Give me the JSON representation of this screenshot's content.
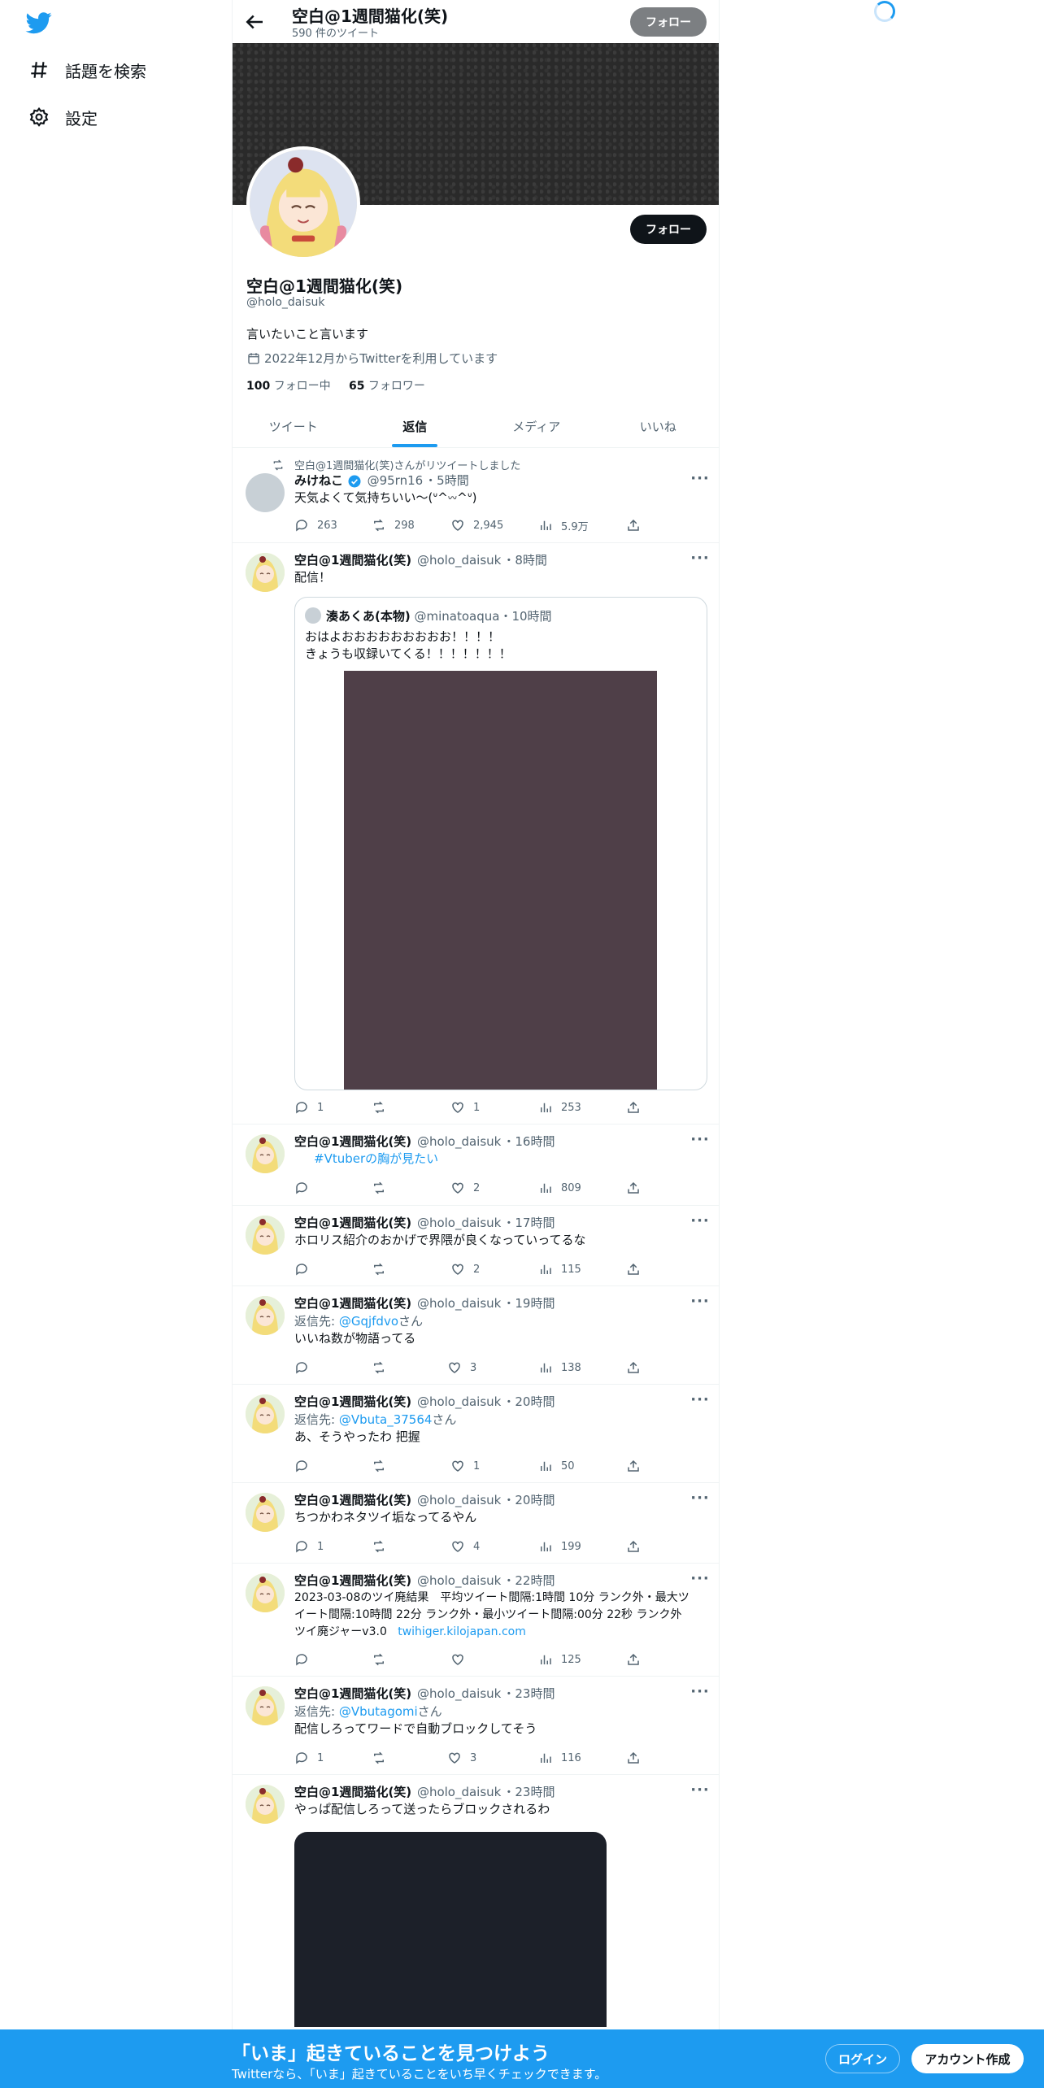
{
  "sidebar": {
    "items": [
      {
        "label": "話題を検索",
        "icon": "hashtag-icon"
      },
      {
        "label": "設定",
        "icon": "gear-icon"
      }
    ]
  },
  "header": {
    "name": "空白@1週間猫化(笑)",
    "tweet_count": "590 件のツイート",
    "follow_label": "フォロー"
  },
  "profile": {
    "name": "空白@1週間猫化(笑)",
    "handle": "@holo_daisuk",
    "bio": "言いたいこと言います",
    "joined": "2022年12月からTwitterを利用しています",
    "following_count": "100",
    "following_label": "フォロー中",
    "followers_count": "65",
    "followers_label": "フォロワー",
    "follow_label": "フォロー"
  },
  "tabs": [
    {
      "label": "ツイート",
      "active": false
    },
    {
      "label": "返信",
      "active": true
    },
    {
      "label": "メディア",
      "active": false
    },
    {
      "label": "いいね",
      "active": false
    }
  ],
  "tweets": [
    {
      "retweeted_by": "空白@1週間猫化(笑)さんがリツイートしました",
      "name": "みけねこ",
      "handle": "@95rn16",
      "time": "・5時間",
      "text": "天気よくて気持ちいい～(ᐡ^𖥦^ᐡ)",
      "replies": "263",
      "retweets": "298",
      "likes": "2,945",
      "views": "5.9万"
    },
    {
      "name": "空白@1週間猫化(笑)",
      "handle": "@holo_daisuk",
      "time": "・8時間",
      "text": "配信！",
      "quote": {
        "name": "湊あくあ(本物)",
        "handle": "@minatoaqua",
        "time": "・10時間",
        "line1": "おはよおおおおおおおおお！！！！",
        "line2": "きょうも収録いてくる！！！！！！！"
      },
      "replies": "1",
      "retweets": "",
      "likes": "1",
      "views": "253"
    },
    {
      "name": "空白@1週間猫化(笑)",
      "handle": "@holo_daisuk",
      "time": "・16時間",
      "text": "#Vtuberの胸が見たい",
      "replies": "",
      "retweets": "",
      "likes": "2",
      "views": "809"
    },
    {
      "name": "空白@1週間猫化(笑)",
      "handle": "@holo_daisuk",
      "time": "・17時間",
      "text": "ホロリス紹介のおかげで界隈が良くなっていってるな",
      "replies": "",
      "retweets": "",
      "likes": "2",
      "views": "115"
    },
    {
      "name": "空白@1週間猫化(笑)",
      "handle": "@holo_daisuk",
      "time": "・19時間",
      "reply_prefix": "返信先: ",
      "reply_to": "@Gqjfdvo",
      "reply_suffix": "さん",
      "text": "いいね数が物語ってる",
      "replies": "",
      "retweets": "",
      "likes": "3",
      "views": "138"
    },
    {
      "name": "空白@1週間猫化(笑)",
      "handle": "@holo_daisuk",
      "time": "・20時間",
      "reply_prefix": "返信先: ",
      "reply_to": "@Vbuta_37564",
      "reply_suffix": "さん",
      "text": "あ、そうやったわ 把握",
      "replies": "",
      "retweets": "",
      "likes": "1",
      "views": "50"
    },
    {
      "name": "空白@1週間猫化(笑)",
      "handle": "@holo_daisuk",
      "time": "・20時間",
      "text": "ちつかわネタツイ垢なってるやん",
      "replies": "1",
      "retweets": "",
      "likes": "4",
      "views": "199"
    },
    {
      "name": "空白@1週間猫化(笑)",
      "handle": "@holo_daisuk",
      "time": "・22時間",
      "text1": "2023-03-08のツイ廃結果　平均ツイート間隔:1時間 10分 ランク外・最大ツ",
      "text2": "イート間隔:10時間 22分 ランク外・最小ツイート間隔:00分 22秒 ランク外",
      "text3": "ツイ廃ジャーv3.0",
      "link": "twihiger.kilojapan.com",
      "replies": "",
      "retweets": "",
      "likes": "",
      "views": "125"
    },
    {
      "name": "空白@1週間猫化(笑)",
      "handle": "@holo_daisuk",
      "time": "・23時間",
      "reply_prefix": "返信先: ",
      "reply_to": "@Vbutagomi",
      "reply_suffix": "さん",
      "text": "配信しろってワードで自動ブロックしてそう",
      "replies": "1",
      "retweets": "",
      "likes": "3",
      "views": "116"
    },
    {
      "name": "空白@1週間猫化(笑)",
      "handle": "@holo_daisuk",
      "time": "・23時間",
      "text": "やっぱ配信しろって送ったらブロックされるわ"
    }
  ],
  "bottom_banner": {
    "title": "「いま」起きていることを見つけよう",
    "subtitle": "Twitterなら、「いま」起きていることをいち早くチェックできます。",
    "login_label": "ログイン",
    "signup_label": "アカウント作成"
  },
  "colors": {
    "accent": "#1d9bf0",
    "text": "#0f1419",
    "muted": "#536471"
  }
}
